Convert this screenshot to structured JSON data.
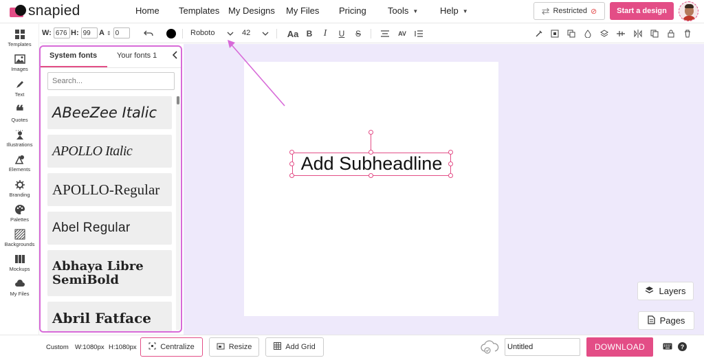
{
  "brand": {
    "logo_text": "snapied",
    "accent_color": "#e34d86",
    "annotation_color": "#d76ad8",
    "canvas_bg": "#eee9fb"
  },
  "nav": {
    "links": [
      {
        "label": "Home"
      },
      {
        "label": "Templates"
      },
      {
        "label": "My Designs"
      },
      {
        "label": "My Files"
      },
      {
        "label": "Pricing"
      },
      {
        "label": "Tools"
      },
      {
        "label": "Help"
      }
    ],
    "restricted_label": "Restricted",
    "start_label": "Start a design"
  },
  "toolbar": {
    "w_label": "W:",
    "w_value": "676",
    "h_label": "H:",
    "h_value": "99",
    "a_label": "A",
    "a_value": "0",
    "font_family": "Roboto",
    "font_size": "42",
    "text_color": "#000000"
  },
  "sidebar": {
    "items": [
      {
        "label": "Templates",
        "icon": "templates-icon"
      },
      {
        "label": "Images",
        "icon": "image-icon"
      },
      {
        "label": "Text",
        "icon": "pen-icon"
      },
      {
        "label": "Quotes",
        "icon": "quote-icon"
      },
      {
        "label": "Illustrations",
        "icon": "illustration-icon"
      },
      {
        "label": "Elements",
        "icon": "shapes-icon"
      },
      {
        "label": "Branding",
        "icon": "branding-icon"
      },
      {
        "label": "Palettes",
        "icon": "palette-icon"
      },
      {
        "label": "Backgrounds",
        "icon": "backgrounds-icon"
      },
      {
        "label": "Mockups",
        "icon": "mockups-icon"
      },
      {
        "label": "My Files",
        "icon": "cloud-files-icon"
      }
    ]
  },
  "font_panel": {
    "tab_system": "System fonts",
    "tab_yours": "Your fonts 1",
    "search_placeholder": "Search...",
    "fonts": [
      {
        "name": "ABeeZee Italic"
      },
      {
        "name": "APOLLO Italic"
      },
      {
        "name": "APOLLO-Regular"
      },
      {
        "name": "Abel Regular"
      },
      {
        "name": "Abhaya Libre SemiBold"
      },
      {
        "name": "Abril Fatface"
      }
    ]
  },
  "canvas": {
    "headline_text": "Add Subheadline",
    "layers_label": "Layers",
    "pages_label": "Pages"
  },
  "bottom": {
    "size_label": "Custom",
    "width_text": "W:1080px",
    "height_text": "H:1080px",
    "centralize_label": "Centralize",
    "resize_label": "Resize",
    "add_grid_label": "Add Grid",
    "title_value": "Untitled",
    "download_label": "DOWNLOAD"
  }
}
